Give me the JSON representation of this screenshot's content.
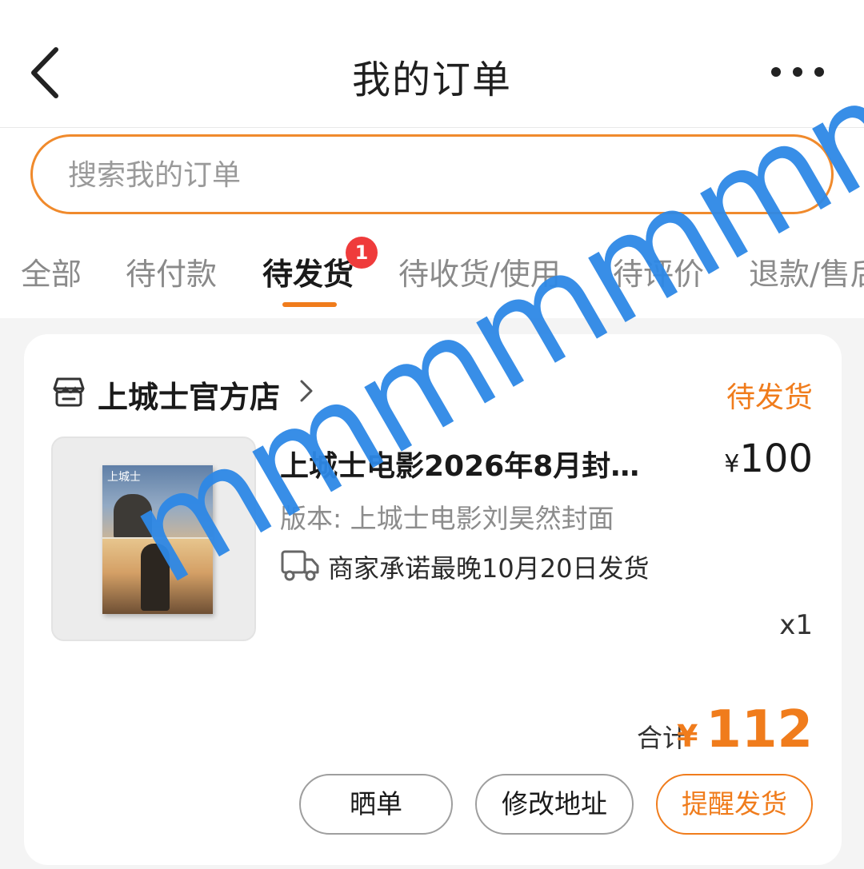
{
  "header": {
    "title": "我的订单"
  },
  "search": {
    "placeholder": "搜索我的订单"
  },
  "tabs": [
    {
      "label": "全部"
    },
    {
      "label": "待付款"
    },
    {
      "label": "待发货",
      "badge": "1"
    },
    {
      "label": "待收货/使用"
    },
    {
      "label": "待评价"
    },
    {
      "label": "退款/售后"
    }
  ],
  "order": {
    "store_name": "上城士官方店",
    "status": "待发货",
    "product_title": "上城士电影2026年8月封…",
    "cover_text": "上城士",
    "price_symbol": "¥",
    "price": "100",
    "variant": "版本: 上城士电影刘昊然封面",
    "shipping_note": "商家承诺最晚10月20日发货",
    "quantity": "x1",
    "total_label": "合计",
    "total_symbol": "¥",
    "total": "112",
    "buttons": {
      "show": "晒单",
      "address": "修改地址",
      "remind": "提醒发货"
    }
  },
  "watermark": "mmmmmmmmm",
  "colors": {
    "accent": "#f07c1c",
    "badge": "#ef3b3b",
    "watermark": "#2e88e6"
  }
}
